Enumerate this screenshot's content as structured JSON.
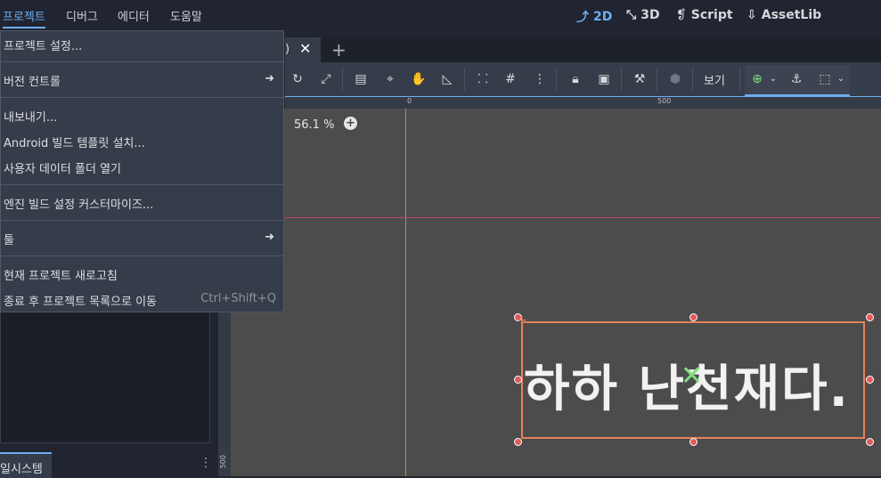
{
  "menubar": {
    "items": [
      "프로젝트",
      "디버그",
      "에디터",
      "도움말"
    ],
    "workspaces": [
      {
        "icon": "2d-icon",
        "label": "2D"
      },
      {
        "icon": "3d-icon",
        "label": "3D"
      },
      {
        "icon": "script-icon",
        "label": "Script"
      },
      {
        "icon": "assetlib-icon",
        "label": "AssetLib"
      }
    ]
  },
  "tabs": {
    "tail": ")",
    "add": "+"
  },
  "toolbar": {
    "view_label": "보기"
  },
  "viewport": {
    "zoom": "56.1 %",
    "ruler_top": [
      "0",
      "500"
    ],
    "ruler_left": [
      "500"
    ],
    "label_text": "하하 난천재다."
  },
  "dock": {
    "tab_label": "일시스템"
  },
  "dropdown": {
    "items": [
      {
        "label": "프로젝트 설정..."
      },
      {
        "label": "버전 컨트롤",
        "arrow": "➜"
      },
      {
        "label": "내보내기..."
      },
      {
        "label": "Android 빌드 템플릿 설치..."
      },
      {
        "label": "사용자 데이터 폴더 열기"
      },
      {
        "label": "엔진 빌드 설정 커스터마이즈..."
      },
      {
        "label": "툴",
        "arrow": "➜"
      },
      {
        "label": "현재 프로젝트 새로고침"
      },
      {
        "label": "종료 후 프로젝트 목록으로 이동",
        "shortcut": "Ctrl+Shift+Q"
      }
    ]
  }
}
